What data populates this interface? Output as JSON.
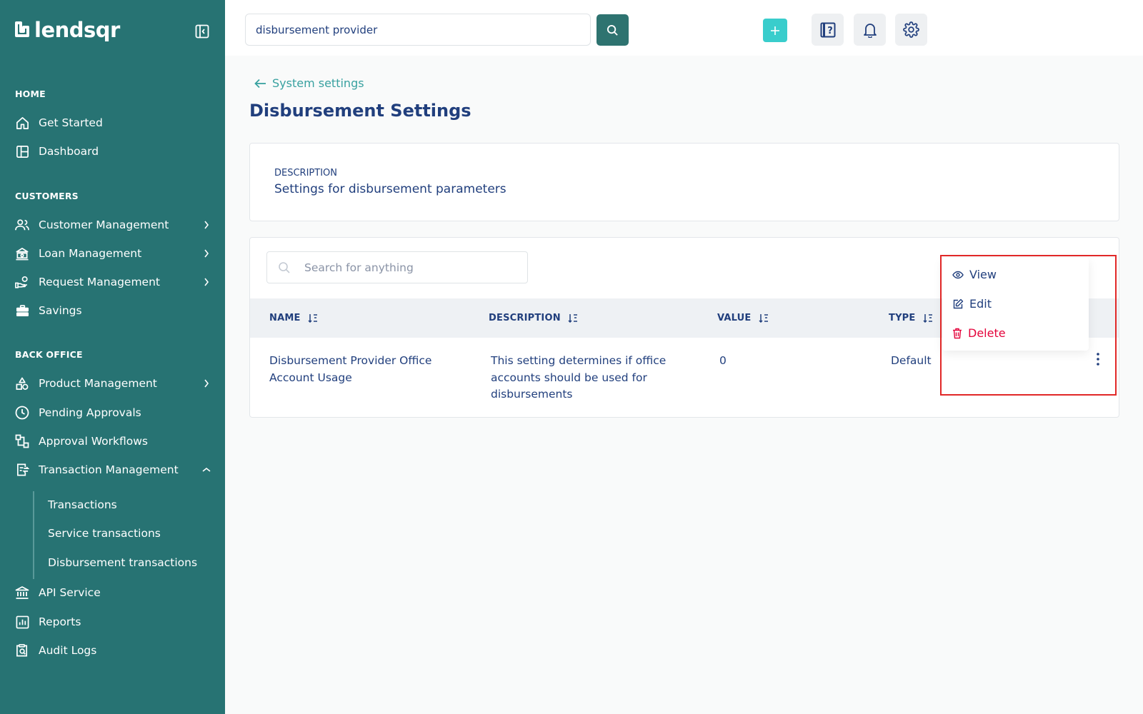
{
  "brand": {
    "name": "lendsqr"
  },
  "sidebar": {
    "sections": {
      "home": "HOME",
      "customers": "CUSTOMERS",
      "back_office": "BACK OFFICE"
    },
    "items": {
      "get_started": "Get Started",
      "dashboard": "Dashboard",
      "customer_management": "Customer Management",
      "loan_management": "Loan Management",
      "request_management": "Request Management",
      "savings": "Savings",
      "product_management": "Product Management",
      "pending_approvals": "Pending Approvals",
      "approval_workflows": "Approval Workflows",
      "transaction_management": "Transaction Management",
      "api_service": "API Service",
      "reports": "Reports",
      "audit_logs": "Audit Logs"
    },
    "subitems": {
      "transactions": "Transactions",
      "service_transactions": "Service transactions",
      "disbursement_transactions": "Disbursement transactions"
    }
  },
  "topbar": {
    "search_value": "disbursement provider"
  },
  "breadcrumb": {
    "back_label": "System settings"
  },
  "page": {
    "title": "Disbursement Settings"
  },
  "description_card": {
    "label": "DESCRIPTION",
    "value": "Settings for disbursement parameters"
  },
  "table": {
    "search_placeholder": "Search for anything",
    "columns": {
      "name": "NAME",
      "description": "DESCRIPTION",
      "value": "VALUE",
      "type": "TYPE"
    },
    "rows": [
      {
        "name_line1": "Disbursement Provider Office",
        "name_line2": "Account Usage",
        "desc_line1": "This setting determines if office",
        "desc_line2": "accounts should be used for",
        "desc_line3": "disbursements",
        "value": "0",
        "type": "Default"
      }
    ]
  },
  "row_menu": {
    "view": "View",
    "edit": "Edit",
    "delete": "Delete"
  },
  "colors": {
    "sidebar": "#277373",
    "accent": "#39cdcc",
    "primary_text": "#213f7d",
    "danger": "#e4033b",
    "highlight": "#e12828"
  }
}
